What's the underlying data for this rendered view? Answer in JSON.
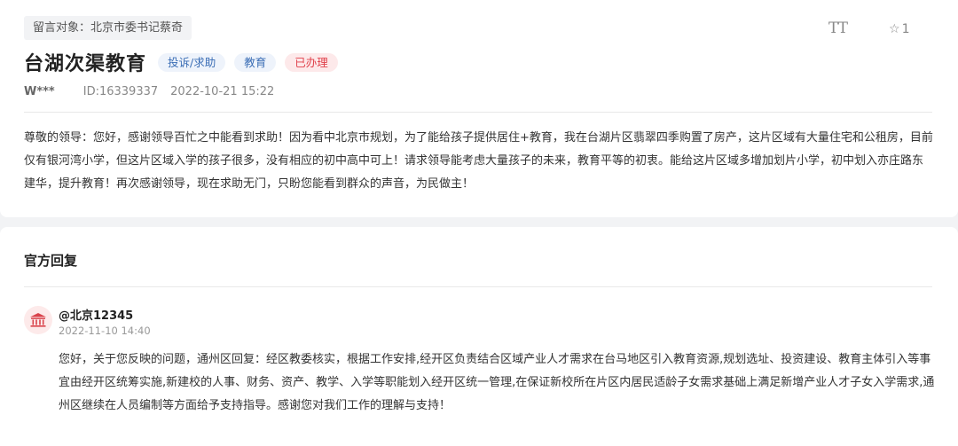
{
  "post": {
    "target_tag": "留言对象：北京市委书记蔡奇",
    "font_toggle": "TT",
    "favorite_count": "1",
    "title": "台湖次渠教育",
    "badges": [
      "投诉/求助",
      "教育",
      "已办理"
    ],
    "user": "W***",
    "id": "ID:16339337",
    "time": "2022-10-21 15:22",
    "content": "尊敬的领导：您好，感谢领导百忙之中能看到求助！因为看中北京市规划，为了能给孩子提供居住+教育，我在台湖片区翡翠四季购置了房产，这片区域有大量住宅和公租房，目前仅有银河湾小学，但这片区域入学的孩子很多，没有相应的初中高中可上！请求领导能考虑大量孩子的未来，教育平等的初衷。能给这片区域多增加划片小学，初中划入亦庄路东建华，提升教育！再次感谢领导，现在求助无门，只盼您能看到群众的声音，为民做主！"
  },
  "reply": {
    "section_title": "官方回复",
    "replier": "@北京12345",
    "time": "2022-11-10 14:40",
    "content": "您好，关于您反映的问题，通州区回复：经区教委核实，根据工作安排,经开区负责结合区域产业人才需求在台马地区引入教育资源,规划选址、投资建设、教育主体引入等事宜由经开区统筹实施,新建校的人事、财务、资产、教学、入学等职能划入经开区统一管理,在保证新校所在片区内居民适龄子女需求基础上满足新增产业人才子女入学需求,通州区继续在人员编制等方面给予支持指导。感谢您对我们工作的理解与支持！"
  },
  "icons": {
    "favorite": "star-outline-icon",
    "avatar": "government-building-icon"
  },
  "colors": {
    "badge_blue_text": "#3a6db5",
    "badge_red_text": "#e0414b",
    "avatar_icon": "#d9434b"
  }
}
